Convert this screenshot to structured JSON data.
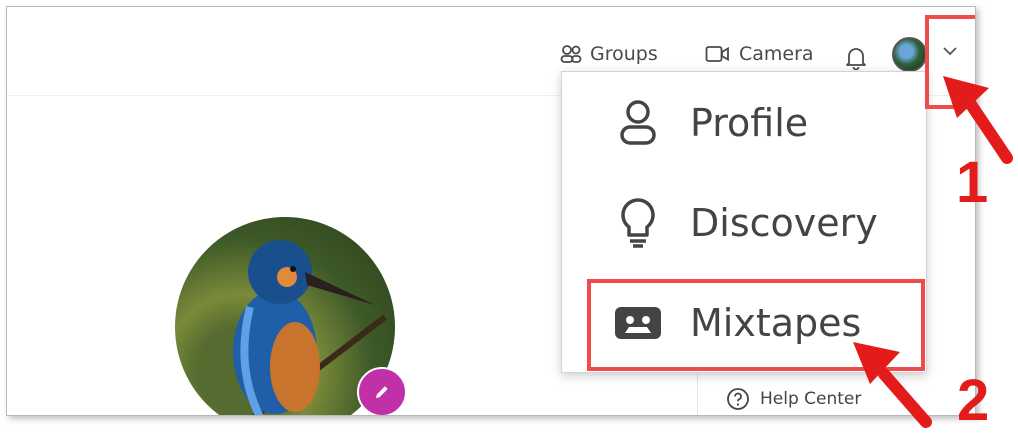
{
  "header": {
    "groups_label": "Groups",
    "camera_label": "Camera"
  },
  "dropdown": {
    "items": [
      {
        "label": "Profile",
        "icon": "person-icon"
      },
      {
        "label": "Discovery",
        "icon": "lightbulb-icon"
      },
      {
        "label": "Mixtapes",
        "icon": "cassette-icon"
      }
    ]
  },
  "sidebar": {
    "help_center_label": "Help Center"
  },
  "annotations": {
    "step1": "1",
    "step2": "2",
    "highlight_color": "#f04a4a",
    "number_color": "#e31b1b"
  },
  "colors": {
    "edit_button": "#c130a8"
  }
}
